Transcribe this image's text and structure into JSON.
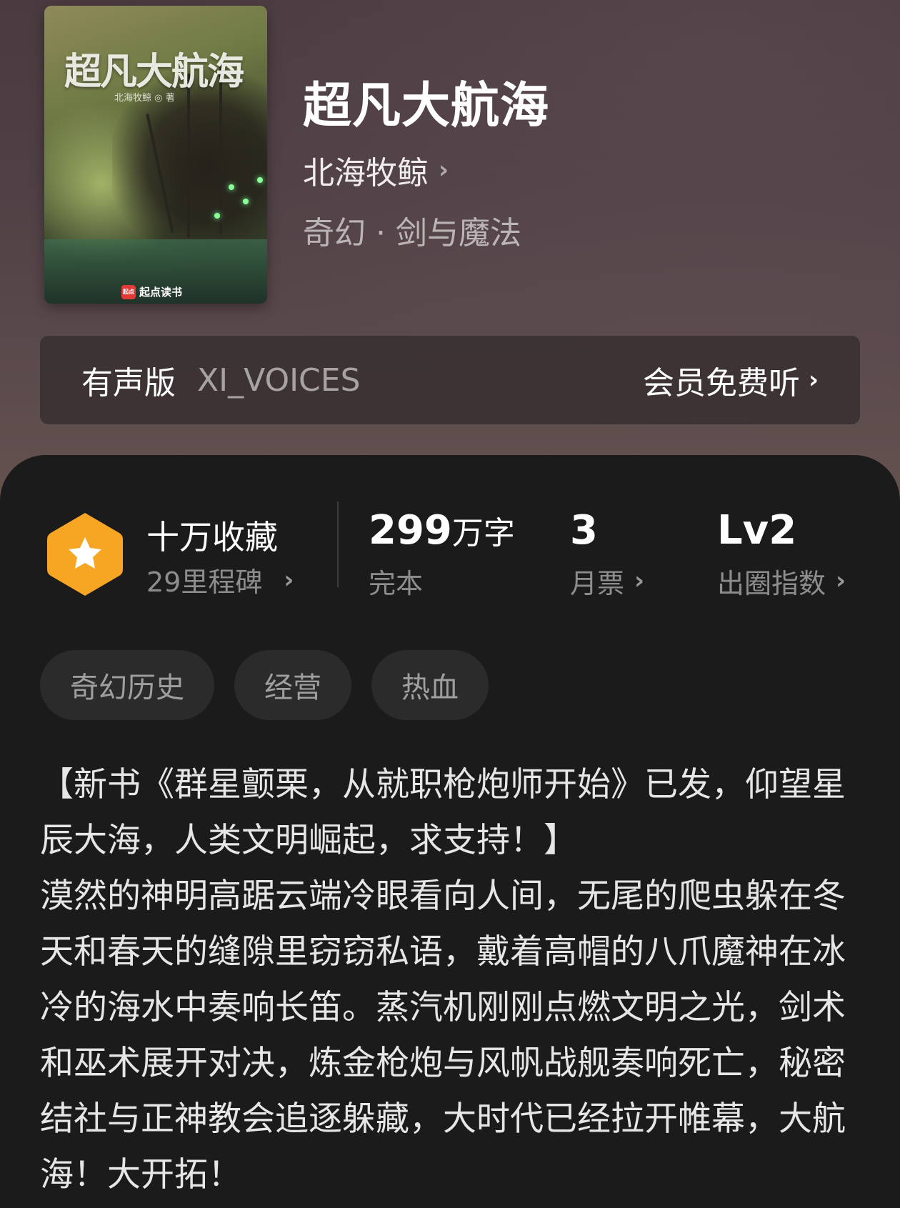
{
  "book": {
    "cover_title": "超凡大航海",
    "cover_author": "北海牧鲸 ◎ 著",
    "cover_brand": "起点读书",
    "cover_brand_badge": "起点",
    "title": "超凡大航海",
    "author": "北海牧鲸",
    "genre": "奇幻 · 剑与魔法"
  },
  "audio": {
    "label": "有声版",
    "voice": "XI_VOICES",
    "action": "会员免费听"
  },
  "stats": {
    "collect_title": "十万收藏",
    "collect_sub": "29里程碑",
    "words_value": "299",
    "words_unit": "万字",
    "words_label": "完本",
    "votes_value": "3",
    "votes_label": "月票",
    "level_value": "Lv2",
    "level_label": "出圈指数"
  },
  "tags": [
    "奇幻历史",
    "经营",
    "热血"
  ],
  "description": {
    "line1": "【新书《群星颤栗，从就职枪炮师开始》已发，仰望星辰大海，人类文明崛起，求支持！】",
    "line2": "漠然的神明高踞云端冷眼看向人间，无尾的爬虫躲在冬天和春天的缝隙里窃窃私语，戴着高帽的八爪魔神在冰冷的海水中奏响长笛。蒸汽机刚刚点燃文明之光，剑术和巫术展开对决，炼金枪炮与风帆战舰奏响死亡，秘密结社与正神教会追逐躲藏，大时代已经拉开帷幕，大航海！大开拓！"
  },
  "colors": {
    "badge_orange": "#f6a623",
    "panel_bg": "#1b1b1b",
    "tag_bg": "#2b2b2b"
  }
}
